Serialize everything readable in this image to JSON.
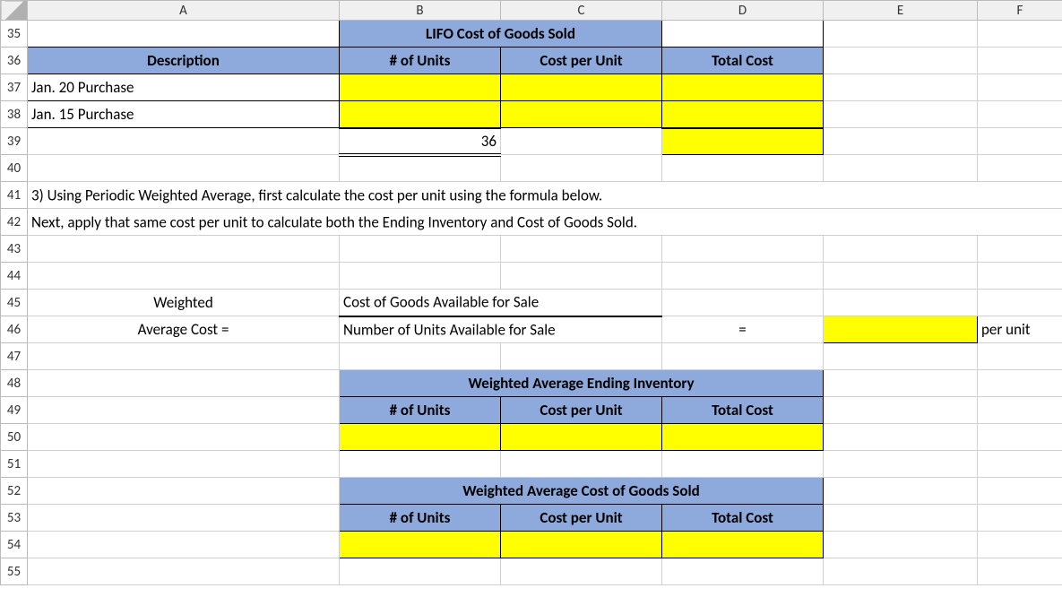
{
  "columns": {
    "A": "A",
    "B": "B",
    "C": "C",
    "D": "D",
    "E": "E",
    "F": "F"
  },
  "rows": {
    "r35": "35",
    "r36": "36",
    "r37": "37",
    "r38": "38",
    "r39": "39",
    "r40": "40",
    "r41": "41",
    "r42": "42",
    "r43": "43",
    "r44": "44",
    "r45": "45",
    "r46": "46",
    "r47": "47",
    "r48": "48",
    "r49": "49",
    "r50": "50",
    "r51": "51",
    "r52": "52",
    "r53": "53",
    "r54": "54",
    "r55": "55"
  },
  "headers": {
    "lifo_title": "LIFO Cost of Goods Sold",
    "description": "Description",
    "units": "# of Units",
    "cost_per_unit": "Cost per Unit",
    "total_cost": "Total Cost",
    "wavg_inv_title": "Weighted Average Ending Inventory",
    "wavg_cogs_title": "Weighted Average Cost of Goods Sold"
  },
  "lifo": {
    "rows": [
      {
        "desc": "Jan. 20 Purchase"
      },
      {
        "desc": "Jan. 15 Purchase"
      }
    ],
    "total_units": "36"
  },
  "text": {
    "q3_line1": "3) Using Periodic Weighted Average, first calculate the cost per unit using the formula below.",
    "q3_line2": "Next, apply that same cost per unit to calculate both the Ending Inventory and Cost of Goods Sold.",
    "weighted": "Weighted",
    "avg_cost_eq": "Average Cost  =",
    "cogas": "Cost of Goods Available for Sale",
    "units_avail": "Number of Units Available for Sale",
    "equals": "=",
    "per_unit": "per unit"
  }
}
